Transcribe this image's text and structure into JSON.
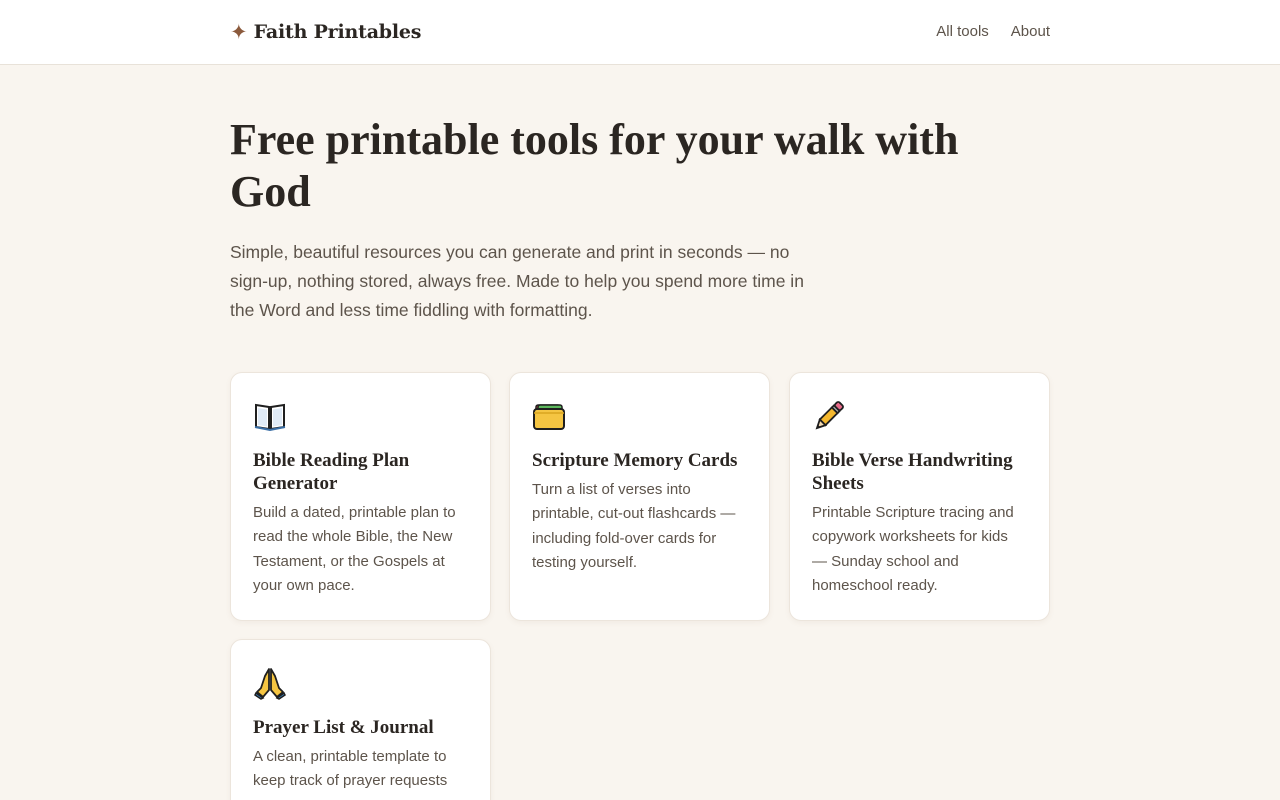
{
  "header": {
    "brand_icon": "sparkle-star-icon",
    "brand_icon_glyph": "✦",
    "brand_name": "Faith Printables",
    "nav": [
      {
        "label": "All tools"
      },
      {
        "label": "About"
      }
    ]
  },
  "hero": {
    "title": "Free printable tools for your walk with God",
    "subtitle": "Simple, beautiful resources you can generate and print in seconds — no sign-up, nothing stored, always free. Made to help you spend more time in the Word and less time fiddling with formatting."
  },
  "cards": [
    {
      "icon": "open-book-icon",
      "title": "Bible Reading Plan Generator",
      "description": "Build a dated, printable plan to read the whole Bible, the New Testament, or the Gospels at your own pace."
    },
    {
      "icon": "card-index-icon",
      "title": "Scripture Memory Cards",
      "description": "Turn a list of verses into printable, cut-out flashcards — including fold-over cards for testing yourself."
    },
    {
      "icon": "pencil-icon",
      "title": "Bible Verse Handwriting Sheets",
      "description": "Printable Scripture tracing and copywork worksheets for kids — Sunday school and homeschool ready."
    },
    {
      "icon": "praying-hands-icon",
      "title": "Prayer List & Journal",
      "description": "A clean, printable template to keep track of prayer requests"
    }
  ],
  "colors": {
    "background": "#f9f5ef",
    "header_background": "#ffffff",
    "brand_accent": "#8b5a3c",
    "heading_text": "#2b2622",
    "body_text": "#5d544b",
    "card_border": "#ece5dc"
  }
}
